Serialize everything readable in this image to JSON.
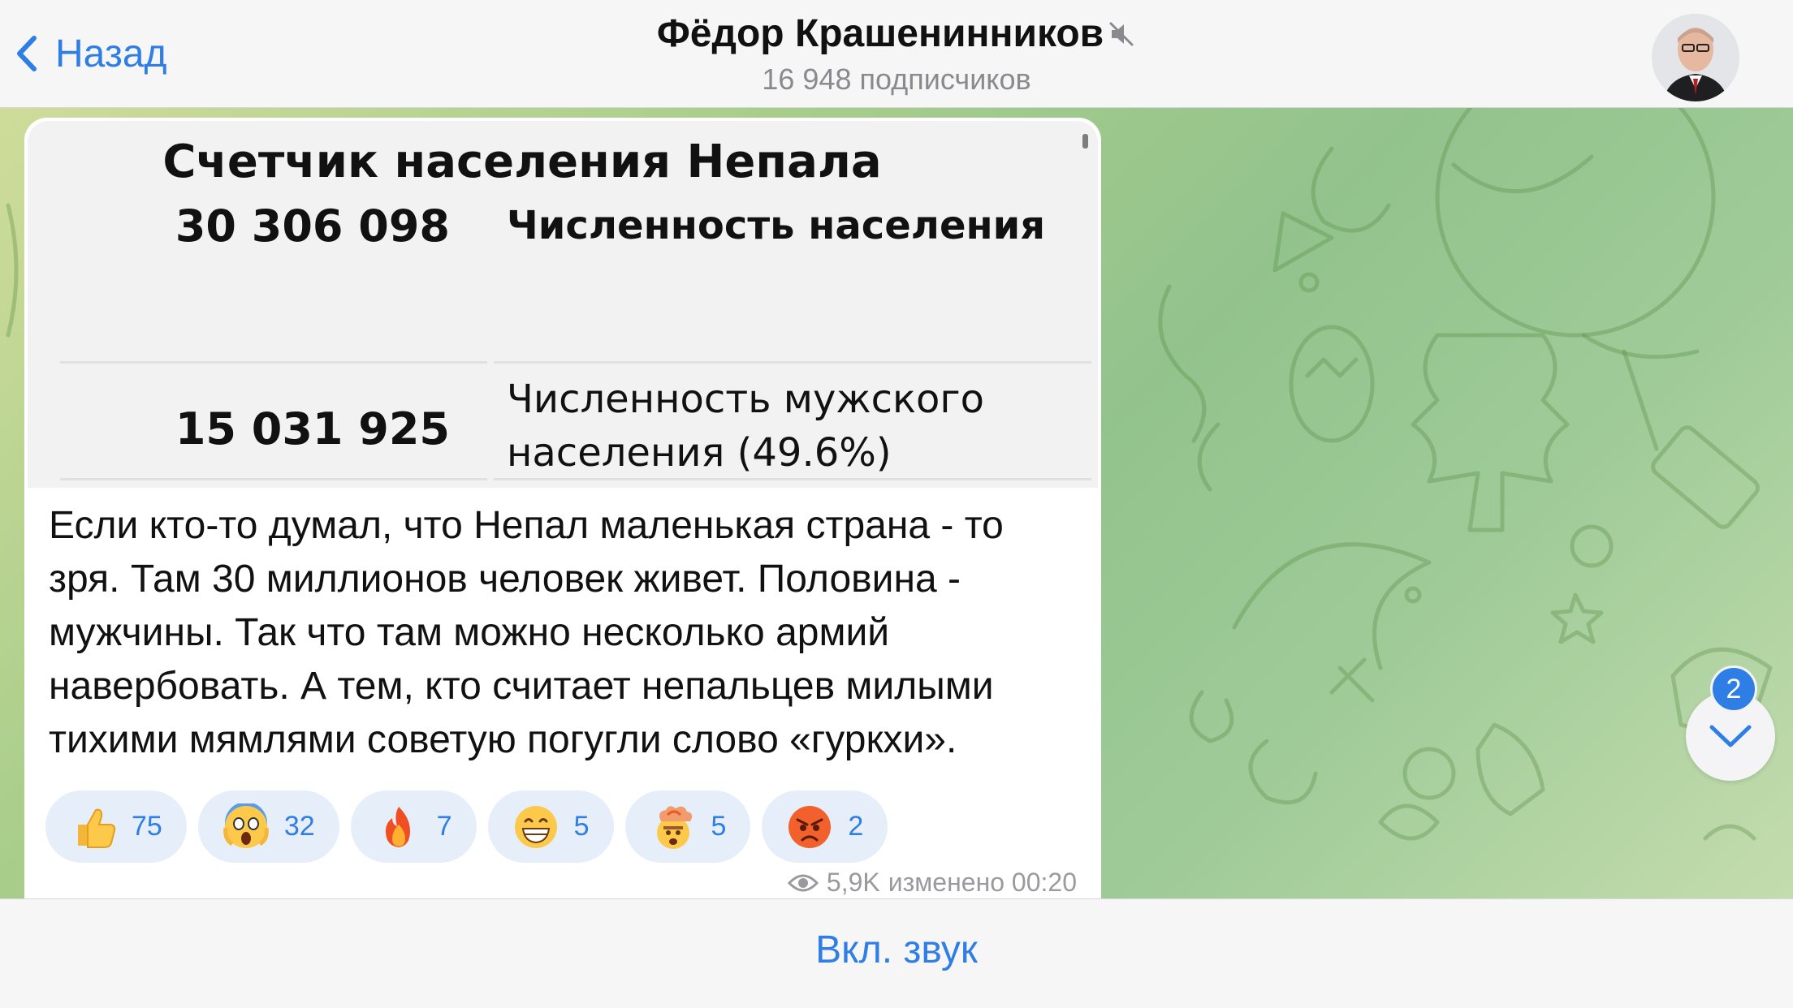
{
  "header": {
    "back_label": "Назад",
    "channel_name": "Фёдор Крашенинников",
    "subscribers": "16 948 подписчиков",
    "muted_icon": "speaker-muted-icon"
  },
  "post": {
    "card_title": "Счетчик населения Непала",
    "rows": [
      {
        "value": "30 306 098",
        "label": "Численность населения"
      },
      {
        "value": "15 031 925",
        "label_line1": "Численность мужского",
        "label_line2": "населения (49.6%)"
      }
    ],
    "text_lines": [
      "Если кто-то думал, что Непал маленькая страна - то",
      "зря. Там 30 миллионов человек живет. Половина -",
      "мужчины. Так что там можно несколько армий",
      "навербовать. А тем, кто считает непальцев милыми",
      "тихими мямлями советую погугли слово «гуркхи»."
    ],
    "reactions": [
      {
        "emoji": "👍",
        "count": "75",
        "icon": "thumbs-up-icon"
      },
      {
        "emoji": "😱",
        "count": "32",
        "icon": "screaming-face-icon"
      },
      {
        "emoji": "🔥",
        "count": "7",
        "icon": "fire-icon"
      },
      {
        "emoji": "😁",
        "count": "5",
        "icon": "grinning-face-icon"
      },
      {
        "emoji": "🤯",
        "count": "5",
        "icon": "exploding-head-icon"
      },
      {
        "emoji": "😡",
        "count": "2",
        "icon": "angry-face-icon"
      }
    ],
    "views": "5,9K",
    "edited_time": "изменено 00:20"
  },
  "scroll_down": {
    "badge": "2"
  },
  "bottom_bar": {
    "unmute_label": "Вкл. звук"
  },
  "colors": {
    "accent": "#2f7ee5",
    "reaction_bg": "#e6eef9"
  }
}
